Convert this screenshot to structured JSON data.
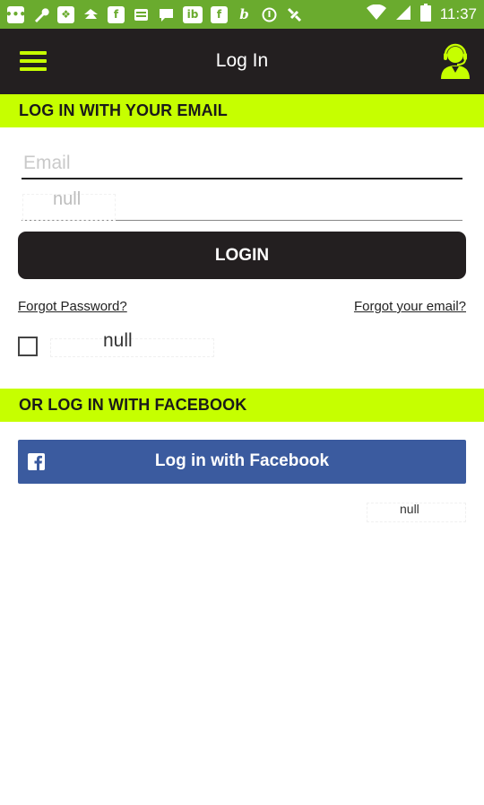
{
  "status_bar": {
    "time": "11:37",
    "icons": [
      "chat-icon",
      "wrench-icon",
      "bbm-icon",
      "zillow-icon",
      "flipboard-icon",
      "stack-icon",
      "chat-bubble-icon",
      "ibotta-icon",
      "flipboard-icon",
      "b-icon",
      "circle-icon",
      "satellite-icon",
      "wifi-icon",
      "signal-icon",
      "battery-icon"
    ]
  },
  "appbar": {
    "title": "Log In"
  },
  "email_section": {
    "header": "LOG IN WITH YOUR EMAIL",
    "email_placeholder": "Email",
    "password_text": "null",
    "login_label": "LOGIN",
    "forgot_password": "Forgot Password?",
    "forgot_email": "Forgot your email?",
    "remember_label": "null"
  },
  "facebook_section": {
    "header": "OR LOG IN WITH FACEBOOK",
    "button_label": "Log in with Facebook",
    "footer_text": "null"
  },
  "colors": {
    "accent": "#c6ff00",
    "dark": "#231f20",
    "facebook": "#3b5b9f",
    "status_bar": "#6aab2e"
  }
}
